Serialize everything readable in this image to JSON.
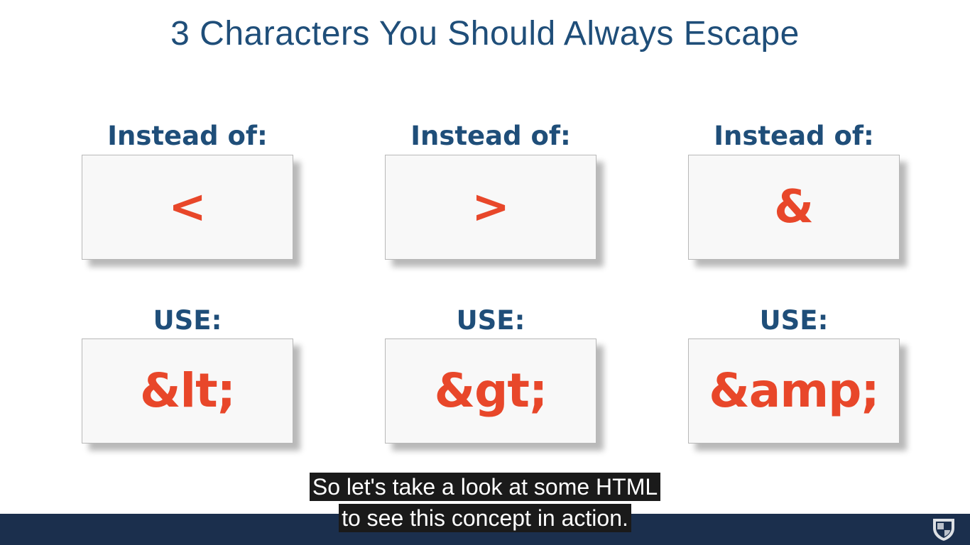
{
  "slide": {
    "title": "3 Characters You Should Always Escape"
  },
  "columns": [
    {
      "instead_label": "Instead of:",
      "character": "<",
      "use_label": "USE:",
      "entity": "&lt;"
    },
    {
      "instead_label": "Instead of:",
      "character": ">",
      "use_label": "USE:",
      "entity": "&gt;"
    },
    {
      "instead_label": "Instead of:",
      "character": "&",
      "use_label": "USE:",
      "entity": "&amp;"
    }
  ],
  "captions": {
    "line1": "So let's take a look at some HTML",
    "line2": "to see this concept in action."
  },
  "colors": {
    "title": "#1f4e79",
    "accent": "#e8472a",
    "footer": "#1b2f4d"
  },
  "icons": {
    "logo": "university-shield-icon"
  }
}
